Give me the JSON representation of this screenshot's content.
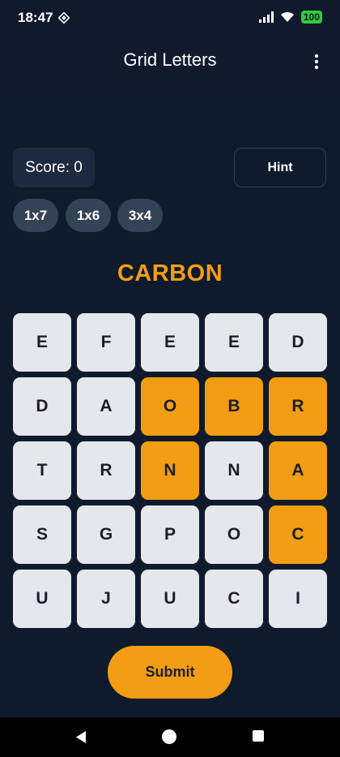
{
  "status_bar": {
    "time": "18:47",
    "battery": "100"
  },
  "app_bar": {
    "title": "Grid Letters"
  },
  "score": {
    "label": "Score: 0"
  },
  "hint": {
    "label": "Hint"
  },
  "size_options": [
    "1x7",
    "1x6",
    "3x4"
  ],
  "target_word": "CARBON",
  "grid": {
    "rows": [
      [
        "E",
        "F",
        "E",
        "E",
        "D"
      ],
      [
        "D",
        "A",
        "O",
        "B",
        "R"
      ],
      [
        "T",
        "R",
        "N",
        "N",
        "A"
      ],
      [
        "S",
        "G",
        "P",
        "O",
        "C"
      ],
      [
        "U",
        "J",
        "U",
        "C",
        "I"
      ]
    ],
    "selected": [
      [
        1,
        2
      ],
      [
        1,
        3
      ],
      [
        1,
        4
      ],
      [
        2,
        2
      ],
      [
        2,
        4
      ],
      [
        3,
        4
      ]
    ]
  },
  "submit": {
    "label": "Submit"
  },
  "colors": {
    "background": "#0f1a2c",
    "accent": "#f29d13",
    "tile": "#e4e7eb",
    "chip": "#344256"
  }
}
